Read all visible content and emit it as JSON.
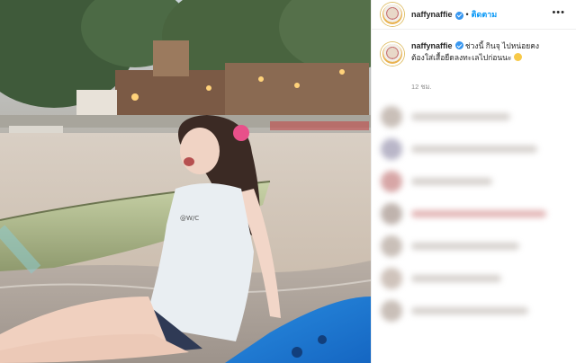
{
  "post": {
    "username": "naffynaffie",
    "follow_label": "ติดตาม",
    "more_label": "•••",
    "separator": "•",
    "caption": {
      "username": "naffynaffie",
      "line1": "ช่วงนี้ กินจุ ไปหน่อยคง",
      "line2": "ต้องใส่เสื้อยืดลงทะเลไปก่อนนะ"
    },
    "time": "12 ชม."
  },
  "colors": {
    "link_blue": "#0095f6",
    "verified_blue": "#3897f0",
    "text": "#262626",
    "muted": "#8e8e8e"
  },
  "icons": {
    "verified": "verified-badge-icon",
    "emoji": "grinning-face-emoji-icon",
    "more": "more-options-icon"
  }
}
